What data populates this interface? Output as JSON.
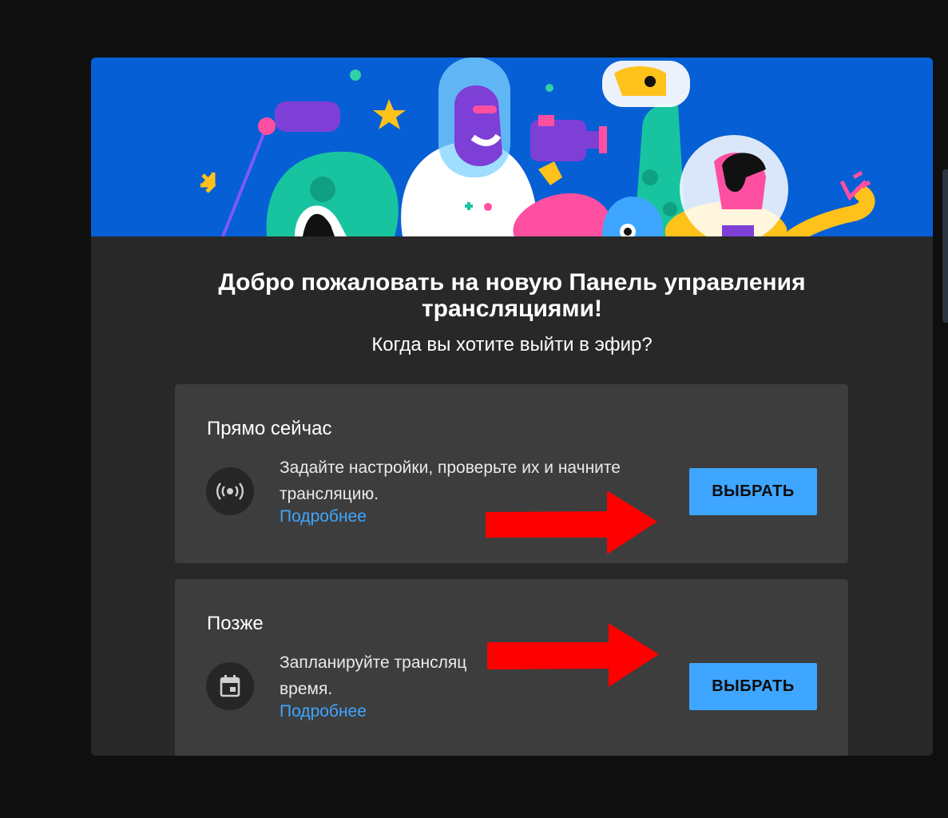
{
  "dialog": {
    "title": "Добро пожаловать на новую Панель управления трансляциями!",
    "subtitle": "Когда вы хотите выйти в эфир?"
  },
  "options": [
    {
      "title": "Прямо сейчас",
      "description": "Задайте настройки, проверьте их и начните трансляцию.",
      "link": "Подробнее",
      "button": "ВЫБРАТЬ",
      "icon": "live-broadcast-icon"
    },
    {
      "title": "Позже",
      "description": "Запланируйте трансляц",
      "description_end": "время.",
      "link": "Подробнее",
      "button": "ВЫБРАТЬ",
      "icon": "calendar-icon"
    }
  ],
  "colors": {
    "banner": "#065fd4",
    "dialog_bg": "#282828",
    "card_bg": "#3d3d3d",
    "accent": "#3ea6ff",
    "annotation_arrow": "#ff0000"
  }
}
